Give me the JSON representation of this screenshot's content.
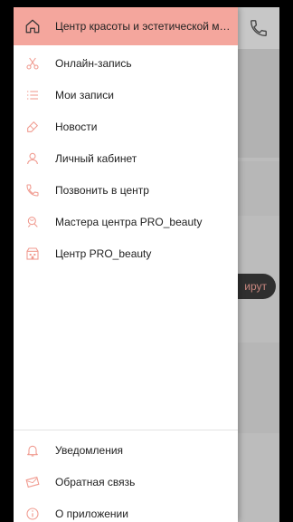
{
  "drawer": {
    "title": "Центр красоты и эстетической медиц...",
    "items": [
      {
        "label": "Онлайн-запись",
        "icon": "scissors-icon"
      },
      {
        "label": "Мои записи",
        "icon": "list-icon"
      },
      {
        "label": "Новости",
        "icon": "megaphone-icon"
      },
      {
        "label": "Личный кабинет",
        "icon": "user-icon"
      },
      {
        "label": "Позвонить в центр",
        "icon": "phone-icon"
      },
      {
        "label": "Мастера центра PRO_beauty",
        "icon": "masters-icon"
      },
      {
        "label": "Центр PRO_beauty",
        "icon": "building-icon"
      }
    ],
    "bottom_items": [
      {
        "label": "Уведомления",
        "icon": "bell-icon"
      },
      {
        "label": "Обратная связь",
        "icon": "feedback-icon"
      },
      {
        "label": "О приложении",
        "icon": "info-icon"
      }
    ]
  },
  "background": {
    "pill_label": "ирут"
  },
  "colors": {
    "accent": "#f4a69d",
    "icon": "#f09a8f"
  }
}
